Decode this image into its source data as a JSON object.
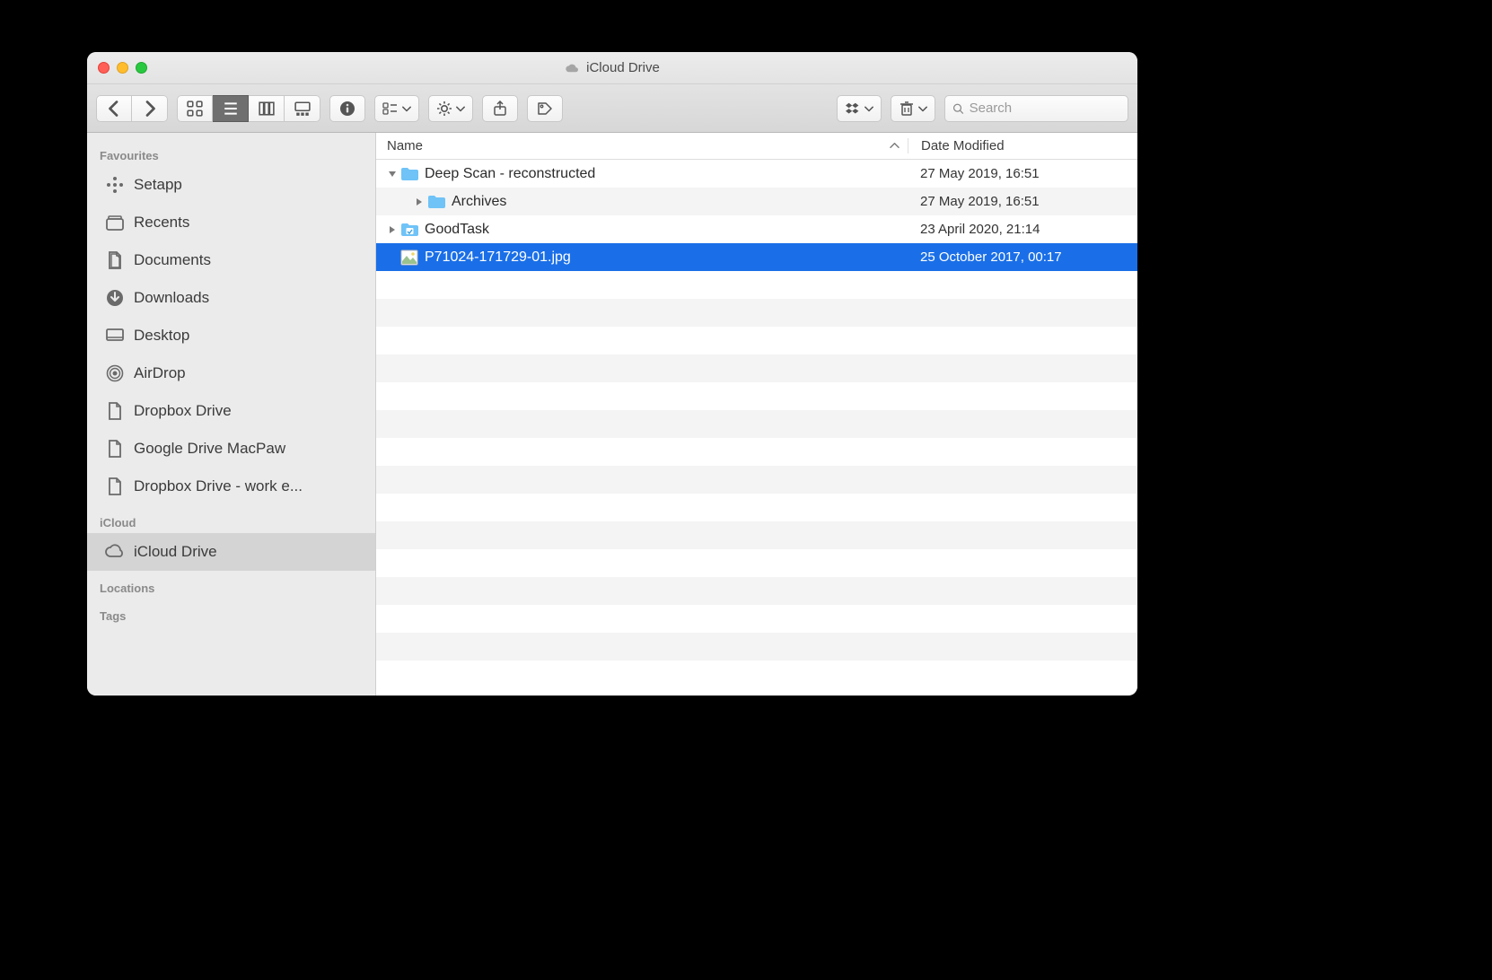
{
  "window": {
    "title": "iCloud Drive"
  },
  "toolbar": {
    "search_placeholder": "Search"
  },
  "sidebar": {
    "sections": [
      {
        "label": "Favourites",
        "items": [
          {
            "icon": "setapp",
            "label": "Setapp"
          },
          {
            "icon": "recents",
            "label": "Recents"
          },
          {
            "icon": "documents",
            "label": "Documents"
          },
          {
            "icon": "downloads",
            "label": "Downloads"
          },
          {
            "icon": "desktop",
            "label": "Desktop"
          },
          {
            "icon": "airdrop",
            "label": "AirDrop"
          },
          {
            "icon": "file",
            "label": "Dropbox Drive"
          },
          {
            "icon": "file",
            "label": "Google Drive MacPaw"
          },
          {
            "icon": "file",
            "label": "Dropbox Drive - work e..."
          }
        ]
      },
      {
        "label": "iCloud",
        "items": [
          {
            "icon": "cloud",
            "label": "iCloud Drive",
            "selected": true
          }
        ]
      },
      {
        "label": "Locations",
        "items": []
      },
      {
        "label": "Tags",
        "items": []
      }
    ]
  },
  "columns": {
    "name": "Name",
    "date": "Date Modified"
  },
  "files": [
    {
      "indent": 0,
      "disclosure": "down",
      "icon": "folder",
      "name": "Deep Scan - reconstructed",
      "date": "27 May 2019, 16:51"
    },
    {
      "indent": 1,
      "disclosure": "right",
      "icon": "folder",
      "name": "Archives",
      "date": "27 May 2019, 16:51"
    },
    {
      "indent": 0,
      "disclosure": "right",
      "icon": "appfolder",
      "name": "GoodTask",
      "date": "23 April 2020, 21:14"
    },
    {
      "indent": 0,
      "disclosure": "none",
      "icon": "image",
      "name": "P71024-171729-01.jpg",
      "date": "25 October 2017, 00:17",
      "selected": true
    }
  ],
  "empty_rows": 15
}
